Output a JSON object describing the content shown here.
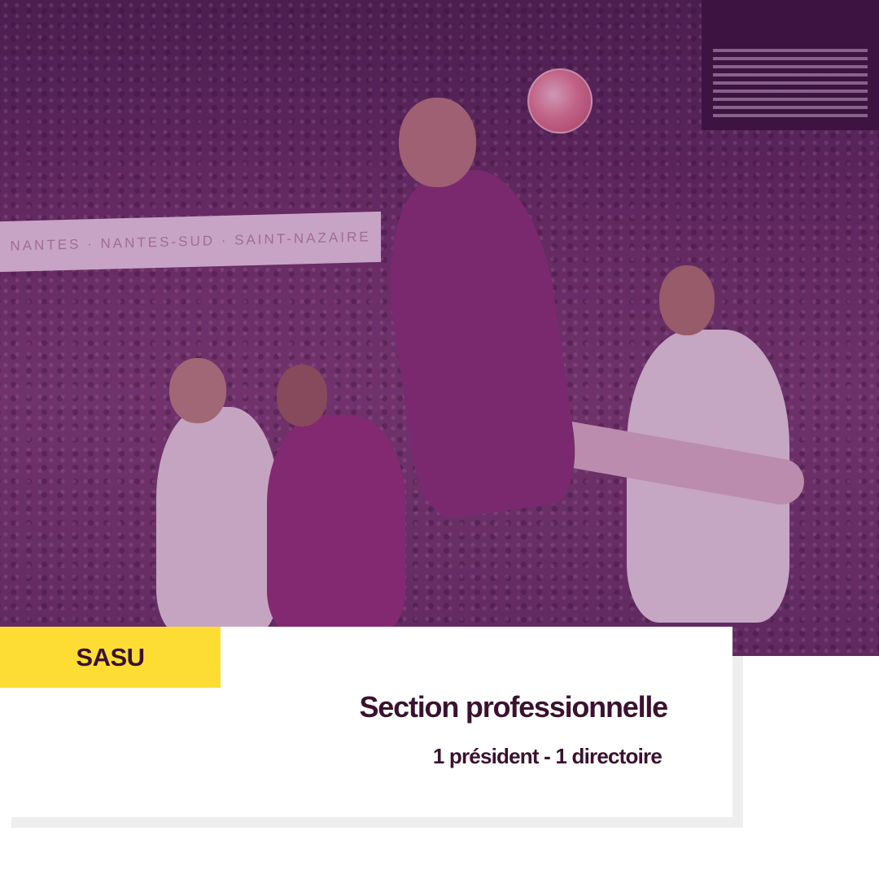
{
  "photo": {
    "banner_text": "NANTES · NANTES-SUD · SAINT-NAZAIRE",
    "overlay_color": "#6e1e6e"
  },
  "card": {
    "tag_label": "SASU",
    "title": "Section professionnelle",
    "subtitle": "1 président - 1 directoire",
    "tag_color": "#fddd33",
    "text_color": "#3a1230"
  }
}
